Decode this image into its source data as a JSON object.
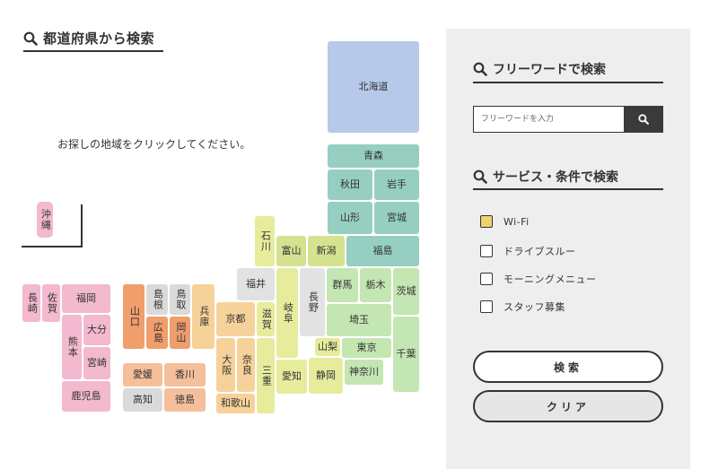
{
  "map_section": {
    "title": "都道府県から検索",
    "instruction": "お探しの地域をクリックしてください。"
  },
  "prefectures": {
    "hokkaido": "北海道",
    "aomori": "青森",
    "akita": "秋田",
    "iwate": "岩手",
    "yamagata": "山形",
    "miyagi": "宮城",
    "niigata": "新潟",
    "fukushima": "福島",
    "ishikawa": "石川",
    "toyama": "富山",
    "fukui": "福井",
    "gifu": "岐阜",
    "nagano": "長野",
    "gunma": "群馬",
    "tochigi": "栃木",
    "ibaraki": "茨城",
    "saitama": "埼玉",
    "yamanashi": "山梨",
    "tokyo": "東京",
    "chiba": "千葉",
    "kanagawa": "神奈川",
    "shizuoka": "静岡",
    "aichi": "愛知",
    "shiga": "滋賀",
    "mie": "三重",
    "kyoto": "京都",
    "hyogo": "兵庫",
    "osaka": "大阪",
    "nara": "奈良",
    "wakayama": "和歌山",
    "tottori": "鳥取",
    "shimane": "島根",
    "okayama": "岡山",
    "hiroshima": "広島",
    "yamaguchi": "山口",
    "ehime": "愛媛",
    "kagawa": "香川",
    "kochi": "高知",
    "tokushima": "徳島",
    "fukuoka": "福岡",
    "saga": "佐賀",
    "nagasaki": "長崎",
    "oita": "大分",
    "kumamoto": "熊本",
    "miyazaki": "宮崎",
    "kagoshima": "鹿児島",
    "okinawa": "沖縄"
  },
  "search_panel": {
    "freeword_title": "フリーワードで検索",
    "search_placeholder": "フリーワードを入力",
    "conditions_title": "サービス・条件で検索",
    "options": [
      {
        "label": "Wi-Fi",
        "checked": true
      },
      {
        "label": "ドライブスルー",
        "checked": false
      },
      {
        "label": "モーニングメニュー",
        "checked": false
      },
      {
        "label": "スタッフ募集",
        "checked": false
      }
    ],
    "search_button": "検索",
    "clear_button": "クリア"
  },
  "icons": {
    "title_icon": "search-icon",
    "button_icon": "search-icon"
  }
}
